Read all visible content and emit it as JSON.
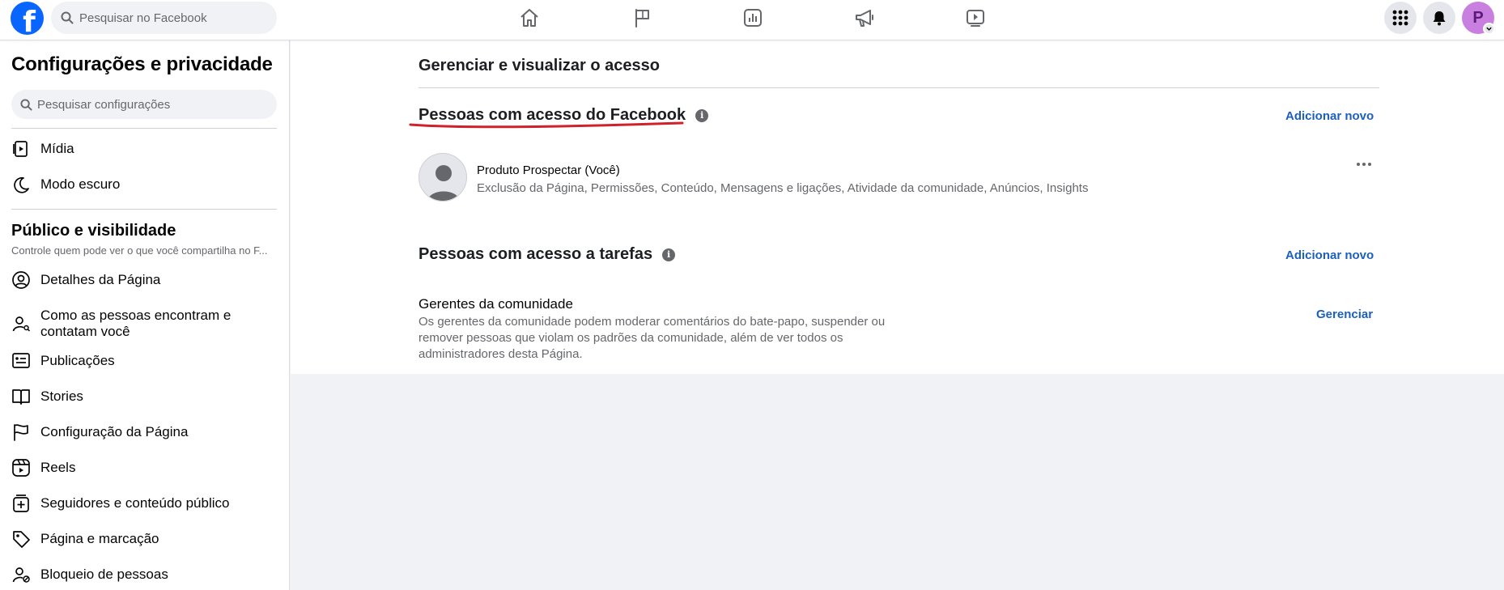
{
  "topbar": {
    "logo_letter": "f",
    "search_placeholder": "Pesquisar no Facebook",
    "nav_icons": [
      "home-icon",
      "flag-icon",
      "insights-icon",
      "megaphone-icon",
      "video-icon"
    ],
    "avatar_letter": "P"
  },
  "sidebar": {
    "title": "Configurações e privacidade",
    "search_placeholder": "Pesquisar configurações",
    "top_items": [
      {
        "label": "Mídia",
        "icon": "media-icon"
      },
      {
        "label": "Modo escuro",
        "icon": "moon-icon"
      }
    ],
    "section_title": "Público e visibilidade",
    "section_subtitle": "Controle quem pode ver o que você compartilha no F...",
    "items": [
      {
        "label": "Detalhes da Página",
        "icon": "user-circle-icon"
      },
      {
        "label": "Como as pessoas encontram e contatam você",
        "icon": "person-search-icon"
      },
      {
        "label": "Publicações",
        "icon": "posts-icon"
      },
      {
        "label": "Stories",
        "icon": "book-icon"
      },
      {
        "label": "Configuração da Página",
        "icon": "flag-icon"
      },
      {
        "label": "Reels",
        "icon": "reels-icon"
      },
      {
        "label": "Seguidores e conteúdo público",
        "icon": "add-box-icon"
      },
      {
        "label": "Página e marcação",
        "icon": "tag-icon"
      },
      {
        "label": "Bloqueio de pessoas",
        "icon": "block-person-icon"
      }
    ]
  },
  "main": {
    "title": "Gerenciar e visualizar o acesso",
    "facebook_access": {
      "title": "Pessoas com acesso do Facebook",
      "add_label": "Adicionar novo",
      "person_name": "Produto Prospectar (Você)",
      "person_permissions": "Exclusão da Página, Permissões, Conteúdo, Mensagens e ligações, Atividade da comunidade, Anúncios, Insights",
      "underline_color": "#d0202a"
    },
    "task_access": {
      "title": "Pessoas com acesso a tarefas",
      "add_label": "Adicionar novo",
      "group_title": "Gerentes da comunidade",
      "group_description": "Os gerentes da comunidade podem moderar comentários do bate-papo, suspender ou remover pessoas que violam os padrões da comunidade, além de ver todos os administradores desta Página.",
      "manage_label": "Gerenciar"
    }
  },
  "colors": {
    "brand_blue": "#0866ff",
    "link_blue": "#1b5fbf",
    "avatar_purple": "#c97fe0"
  }
}
